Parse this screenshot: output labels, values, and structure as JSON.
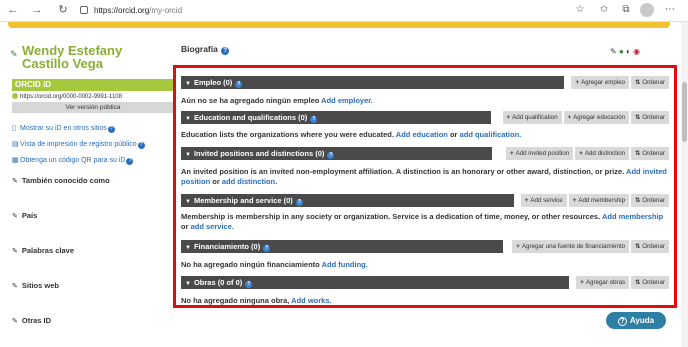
{
  "browser": {
    "url_domain": "https://orcid.org",
    "url_path": "/my-orcid"
  },
  "sidebar": {
    "name_line1": "Wendy Estefany",
    "name_line2": "Castillo Vega",
    "orcid_label": "ORCID iD",
    "orcid_url": "https://orcid.org/0000-0002-9991-1108",
    "public_version_button": "Ver versión pública",
    "links": [
      {
        "label": "Mostrar su iD en otros sitios"
      },
      {
        "label": "Vista de impresión de registro público"
      },
      {
        "label": "Obtenga un código QR para su iD"
      }
    ],
    "sections": [
      {
        "label": "También conocido como"
      },
      {
        "label": "País"
      },
      {
        "label": "Palabras clave"
      },
      {
        "label": "Sitios web"
      },
      {
        "label": "Otras ID"
      }
    ]
  },
  "main": {
    "bio_title": "Biografía",
    "sections": [
      {
        "title": "Empleo (0)",
        "actions": [
          "Agregar empleo",
          "Ordenar"
        ],
        "desc_text": "Aún no se ha agregado ningún empleo",
        "desc_link1": "Add employer.",
        "desc_mid": "",
        "desc_link2": ""
      },
      {
        "title": "Education and qualifications (0)",
        "actions": [
          "Add qualification",
          "Agregar educación",
          "Ordenar"
        ],
        "desc_text": "Education lists the organizations where you were educated.",
        "desc_link1": "Add education",
        "desc_mid": "or",
        "desc_link2": "add qualification."
      },
      {
        "title": "Invited positions and distinctions (0)",
        "actions": [
          "Add invited position",
          "Add distinction",
          "Ordenar"
        ],
        "desc_text": "An invited position is an invited non-employment affiliation. A distinction is an honorary or other award, distinction, or prize.",
        "desc_link1": "Add invited position",
        "desc_mid": "or",
        "desc_link2": "add distinction."
      },
      {
        "title": "Membership and service (0)",
        "actions": [
          "Add service",
          "Add membership",
          "Ordenar"
        ],
        "desc_text": "Membership is membership in any society or organization. Service is a dedication of time, money, or other resources.",
        "desc_link1": "Add membership",
        "desc_mid": "or",
        "desc_link2": "add service."
      },
      {
        "title": "Financiamiento (0)",
        "actions": [
          "Agregar una fuente de financiamiento",
          "Ordenar"
        ],
        "desc_text": "No ha agregado ningún financiamiento",
        "desc_link1": "Add funding.",
        "desc_mid": "",
        "desc_link2": ""
      },
      {
        "title": "Obras (0 of 0)",
        "actions": [
          "Agregar obras",
          "Ordenar"
        ],
        "desc_text": "No ha agregado ninguna obra,",
        "desc_link1": "Add works.",
        "desc_mid": "",
        "desc_link2": ""
      }
    ]
  },
  "help_button": "Ayuda",
  "colors": {
    "name_green": "#8aae33",
    "orcid_green": "#a6c83e",
    "bar_dark": "#4a4a4a",
    "link_blue": "#2a6ebb",
    "highlight_red": "#e20c0c",
    "help_teal": "#2d7fa6"
  }
}
